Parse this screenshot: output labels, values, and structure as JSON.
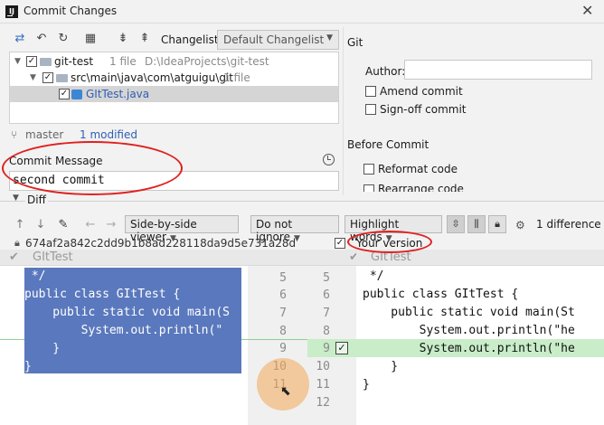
{
  "window": {
    "title": "Commit Changes",
    "close": "✕"
  },
  "toolbar": {
    "icons": [
      "refresh-arrows-icon",
      "undo-icon",
      "redo-icon",
      "group-icon",
      "expand-all-icon",
      "collapse-all-icon"
    ],
    "changelist_label": "Changelist:",
    "changelist_value": "Default Changelist"
  },
  "tree": {
    "root": {
      "name": "git-test",
      "meta": "1 file",
      "path": "D:\\IdeaProjects\\git-test"
    },
    "folder": {
      "name": "src\\main\\java\\com\\atguigu\\git",
      "meta": "1 file"
    },
    "file": {
      "name": "GItTest.java"
    }
  },
  "status": {
    "branch": "master",
    "modified": "1 modified"
  },
  "commit_message": {
    "label": "Commit Message",
    "value": "second commit"
  },
  "git_panel": {
    "title": "Git",
    "author_label": "Author:",
    "author_value": "",
    "amend": "Amend commit",
    "signoff": "Sign-off commit",
    "before_commit": "Before Commit",
    "reformat": "Reformat code",
    "rearrange": "Rearrange code"
  },
  "diff": {
    "label": "Diff",
    "viewer": "Side-by-side viewer",
    "ignore": "Do not ignore",
    "highlight": "Highlight words",
    "difference_count": "1 difference",
    "hash": "674af2a842c2dd9b1b8ad228118da9d5e731a28d",
    "your_version": "Your version",
    "left_title": "GItTest",
    "right_title": "GItTest",
    "left_lines": [
      "5",
      "6",
      "7",
      "8",
      "9",
      "10",
      "11"
    ],
    "right_lines": [
      "5",
      "6",
      "7",
      "8",
      "9",
      "10",
      "11",
      "12"
    ],
    "left_code": [
      " */",
      "public class GItTest {",
      "    public static void main(S",
      "        System.out.println(\"",
      "    }",
      "}"
    ],
    "right_code": [
      " */",
      "public class GItTest {",
      "    public static void main(St",
      "        System.out.println(\"he",
      "        System.out.println(\"he",
      "    }",
      "}"
    ]
  },
  "colors": {
    "selection": "#5a78bd",
    "added": "#c8edc8",
    "annotation": "#e02020",
    "link": "#2f5fb3"
  }
}
